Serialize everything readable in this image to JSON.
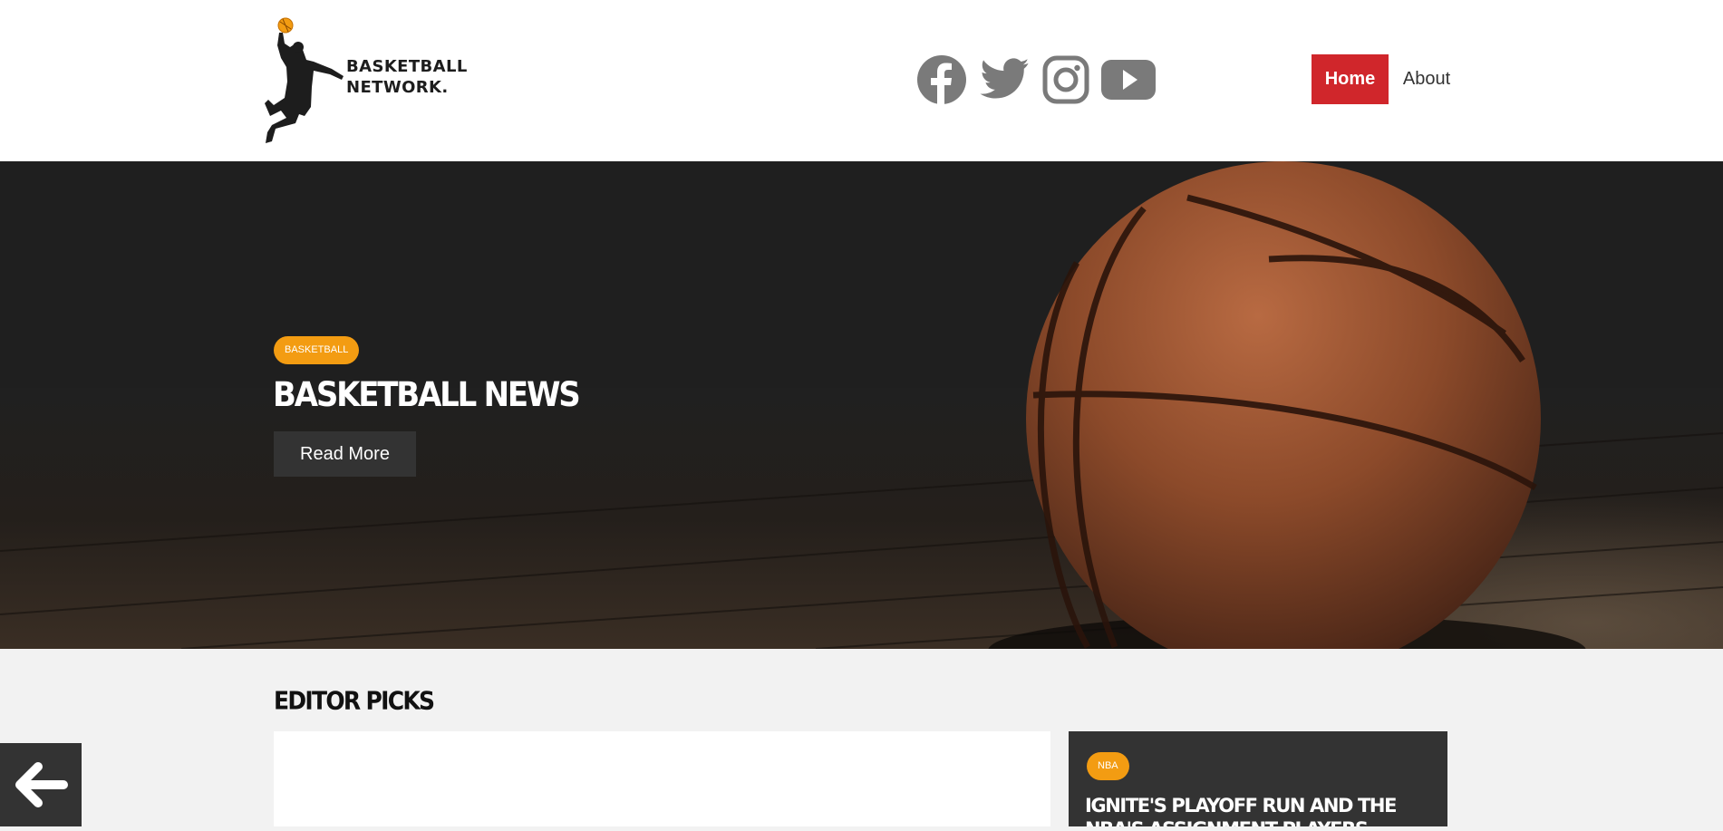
{
  "brand": {
    "line1": "BASKETBALL",
    "line2": "NETWORK.",
    "ball_color": "#f39c12"
  },
  "social": [
    {
      "icon": "facebook-icon",
      "color": "#7a7a7a"
    },
    {
      "icon": "twitter-icon",
      "color": "#7a7a7a"
    },
    {
      "icon": "instagram-icon",
      "color": "#7a7a7a"
    },
    {
      "icon": "youtube-icon",
      "color": "#7a7a7a"
    }
  ],
  "nav": {
    "home": "Home",
    "about": "About",
    "active_color": "#d0262b"
  },
  "hero": {
    "badge": "BASKETBALL",
    "title": "BASKETBALL NEWS",
    "button": "Read More",
    "badge_color": "#f39c12"
  },
  "editor_picks": {
    "title": "EDITOR PICKS",
    "side_card": {
      "badge": "NBA",
      "title": "IGNITE'S PLAYOFF RUN AND THE NBA'S ASSIGNMENT PLAYERS"
    }
  },
  "floating": {
    "back_icon": "arrow-left-icon"
  }
}
